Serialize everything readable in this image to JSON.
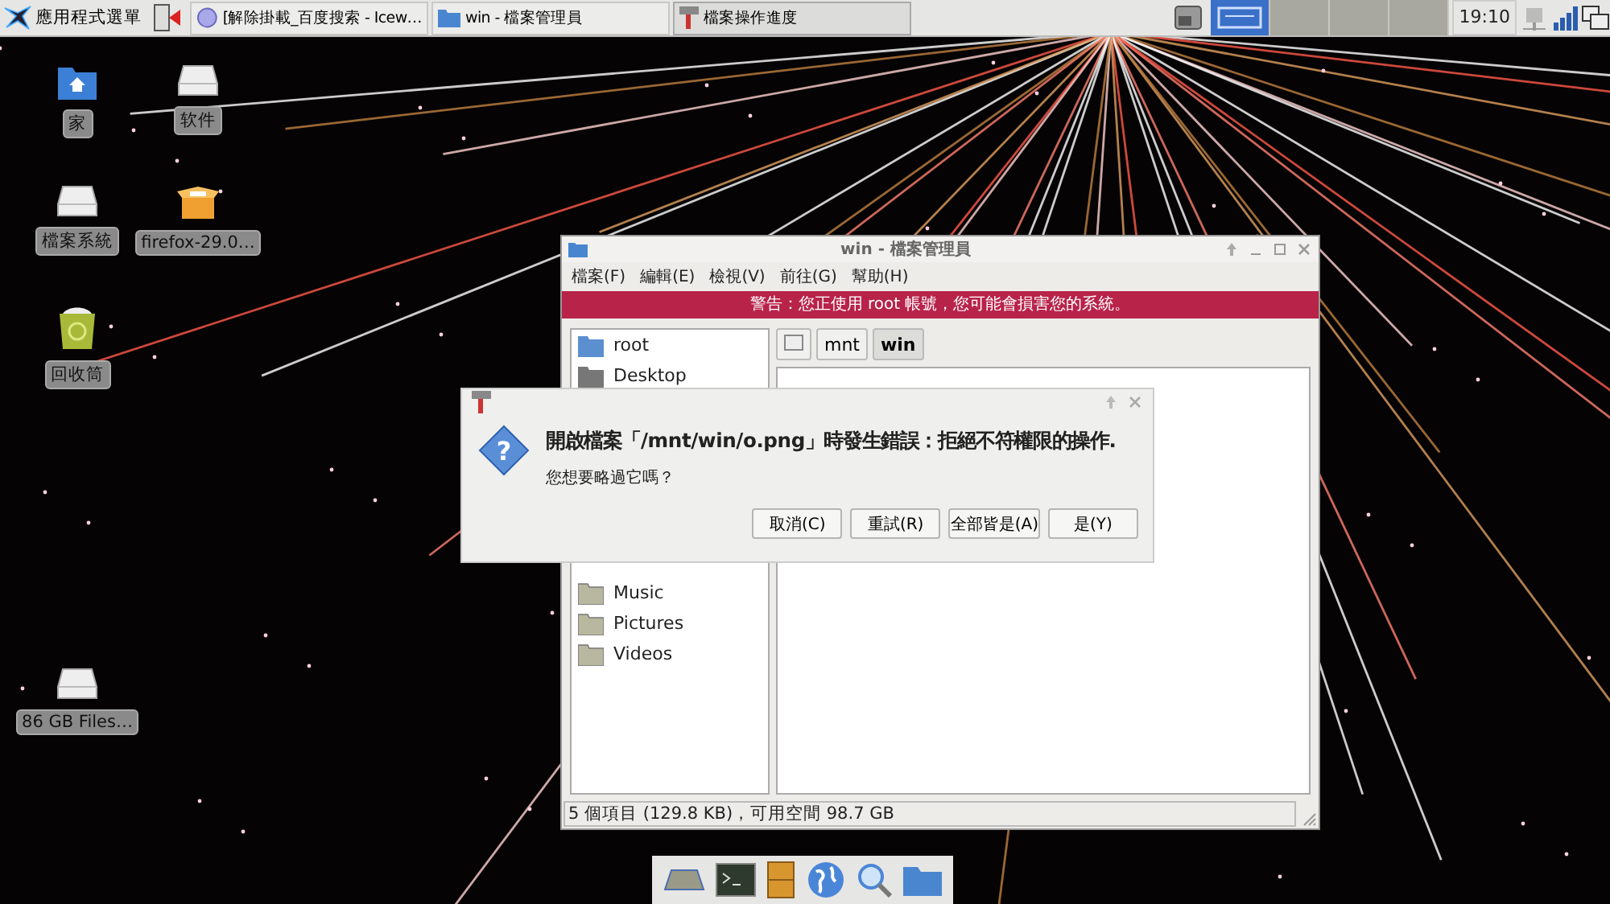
{
  "taskbar": {
    "menu_label": "應用程式選單",
    "tasks": [
      {
        "label": "[解除掛載_百度搜索 - Icew…",
        "kind": "browser",
        "selected": false
      },
      {
        "label": "win - 檔案管理員",
        "kind": "folder",
        "selected": false
      },
      {
        "label": "檔案操作進度",
        "kind": "roller",
        "selected": true
      }
    ],
    "workspaces": [
      {
        "selected": true
      },
      {
        "selected": false
      },
      {
        "selected": false
      },
      {
        "selected": false
      }
    ],
    "clock": "19:10"
  },
  "desktop_icons": [
    {
      "label": "家",
      "kind": "home"
    },
    {
      "label": "软件",
      "kind": "drive"
    },
    {
      "label": "檔案系統",
      "kind": "drive"
    },
    {
      "label": "firefox-29.0…",
      "kind": "package"
    },
    {
      "label": "回收筒",
      "kind": "trash"
    },
    {
      "label": "86 GB Files…",
      "kind": "drive"
    }
  ],
  "file_manager": {
    "title": "win - 檔案管理員",
    "menu": [
      "檔案(F)",
      "編輯(E)",
      "檢視(V)",
      "前往(G)",
      "幫助(H)"
    ],
    "warning": "警告：您正使用 root 帳號，您可能會損害您的系統。",
    "places": [
      {
        "label": "root",
        "kind": "home"
      },
      {
        "label": "Desktop",
        "kind": "desktop"
      }
    ],
    "bookmarks": [
      {
        "label": "Music",
        "kind": "folder"
      },
      {
        "label": "Pictures",
        "kind": "folder"
      },
      {
        "label": "Videos",
        "kind": "folder"
      }
    ],
    "path": [
      {
        "label": "mnt",
        "selected": false
      },
      {
        "label": "win",
        "selected": true
      }
    ],
    "status": "5 個項目 (129.8 KB)，可用空間 98.7 GB"
  },
  "dialog": {
    "message": "開啟檔案「/mnt/win/o.png」時發生錯誤：拒絕不符權限的操作.",
    "question": "您想要略過它嗎？",
    "icon_glyph": "?",
    "buttons": [
      "取消(C)",
      "重試(R)",
      "全部皆是(A)",
      "是(Y)"
    ]
  },
  "dock": [
    {
      "kind": "desktop"
    },
    {
      "kind": "terminal"
    },
    {
      "kind": "cabinet"
    },
    {
      "kind": "globe"
    },
    {
      "kind": "search"
    },
    {
      "kind": "folder"
    }
  ]
}
